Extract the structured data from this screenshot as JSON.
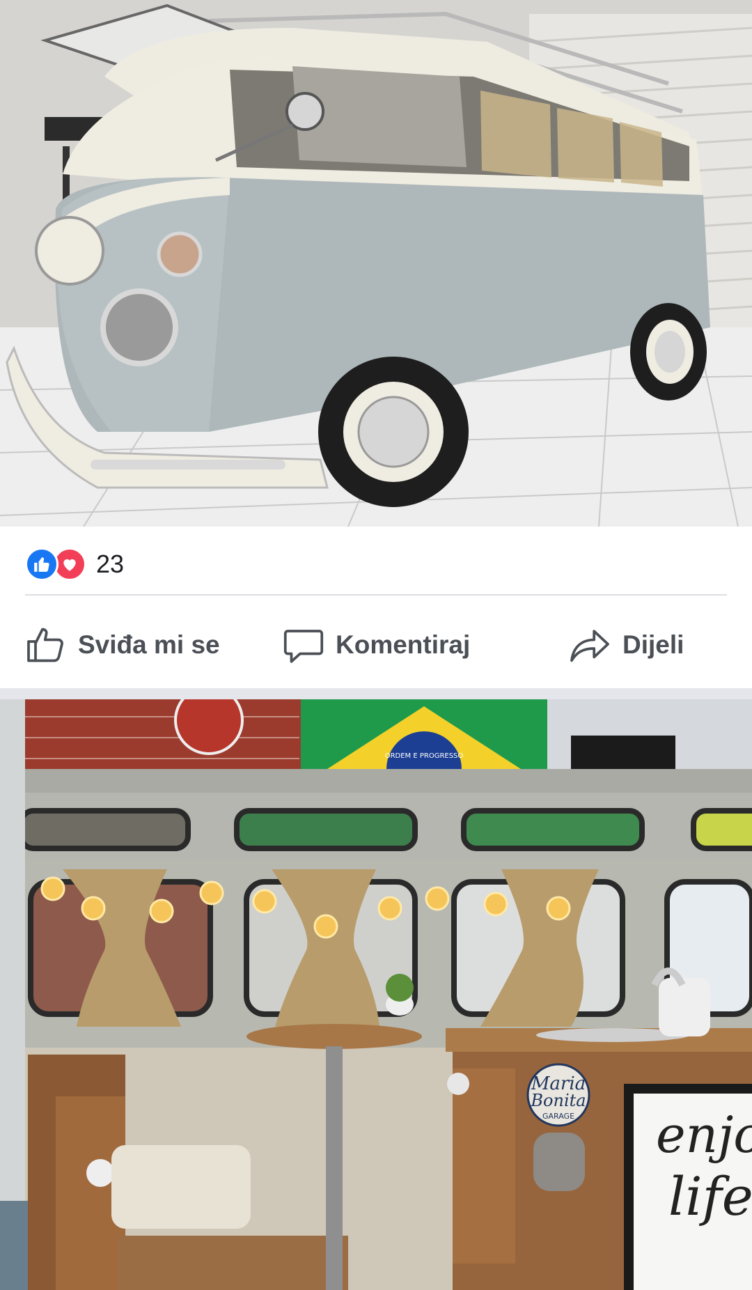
{
  "post": {
    "reactions": {
      "types": [
        "like-icon",
        "love-icon"
      ],
      "count": "23",
      "colors": {
        "like": "#1877f2",
        "love": "#f33e58"
      }
    },
    "actions": {
      "like_label": "Sviđa mi se",
      "comment_label": "Komentiraj",
      "share_label": "Dijeli"
    }
  },
  "photos": {
    "top": {
      "subject": "vw-bus-exterior"
    },
    "bottom": {
      "subject": "vw-bus-interior",
      "sign_text_1": "enjo",
      "sign_text_2": "life",
      "sticker_text_1": "Maria",
      "sticker_text_2": "Bonita",
      "sticker_text_3": "GARAGE",
      "flag_text": "ORDEM E PROGRESSO"
    }
  }
}
